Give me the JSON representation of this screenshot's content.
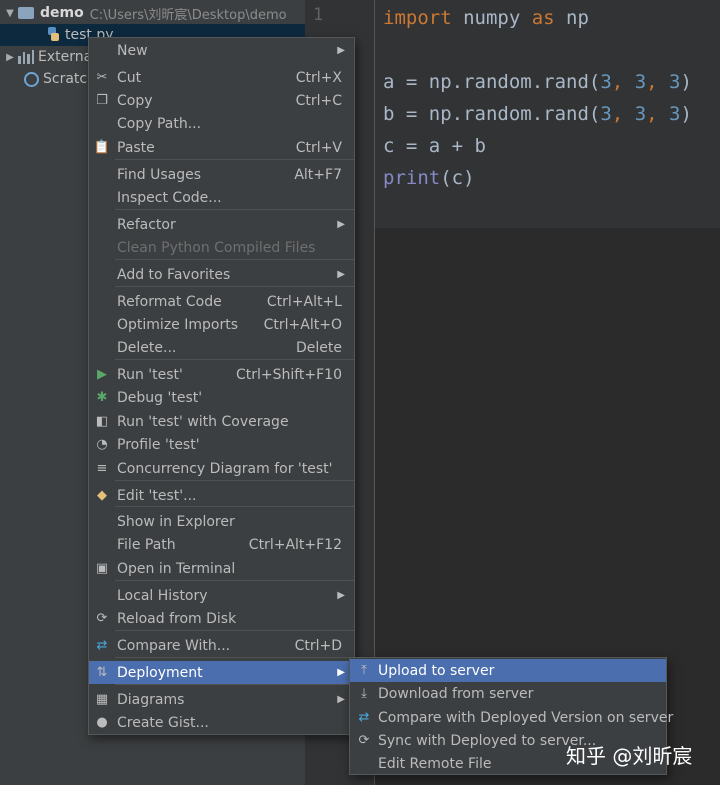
{
  "project_tree": {
    "root_name": "demo",
    "root_path": "C:\\Users\\刘昕宸\\Desktop\\demo",
    "file": "test.py",
    "external": "Externa",
    "scratch": "Scratch"
  },
  "editor": {
    "line_number": "1",
    "lines": [
      [
        "import",
        " numpy ",
        "as",
        " np"
      ],
      [
        "a = np.random.rand(",
        "3",
        ", ",
        "3",
        ", ",
        "3",
        ")"
      ],
      [
        "b = np.random.rand(",
        "3",
        ", ",
        "3",
        ", ",
        "3",
        ")"
      ],
      [
        "c = a + b"
      ],
      [
        "print",
        "(c)"
      ]
    ]
  },
  "context_menu": {
    "items": [
      {
        "label": "New",
        "shortcut": "",
        "icon": "none",
        "submenu": true
      },
      {
        "label": "Cut",
        "shortcut": "Ctrl+X",
        "icon": "scissors-icon"
      },
      {
        "label": "Copy",
        "shortcut": "Ctrl+C",
        "icon": "copy-icon"
      },
      {
        "label": "Copy Path...",
        "shortcut": "",
        "icon": "none"
      },
      {
        "label": "Paste",
        "shortcut": "Ctrl+V",
        "icon": "paste-icon"
      },
      {
        "label": "Find Usages",
        "shortcut": "Alt+F7",
        "icon": "none"
      },
      {
        "label": "Inspect Code...",
        "shortcut": "",
        "icon": "none"
      },
      {
        "label": "Refactor",
        "shortcut": "",
        "icon": "none",
        "submenu": true
      },
      {
        "label": "Clean Python Compiled Files",
        "shortcut": "",
        "icon": "none",
        "disabled": true
      },
      {
        "label": "Add to Favorites",
        "shortcut": "",
        "icon": "none",
        "submenu": true
      },
      {
        "label": "Reformat Code",
        "shortcut": "Ctrl+Alt+L",
        "icon": "none"
      },
      {
        "label": "Optimize Imports",
        "shortcut": "Ctrl+Alt+O",
        "icon": "none"
      },
      {
        "label": "Delete...",
        "shortcut": "Delete",
        "icon": "none"
      },
      {
        "label": "Run 'test'",
        "shortcut": "Ctrl+Shift+F10",
        "icon": "run-icon"
      },
      {
        "label": "Debug 'test'",
        "shortcut": "",
        "icon": "debug-icon"
      },
      {
        "label": "Run 'test' with Coverage",
        "shortcut": "",
        "icon": "coverage-icon"
      },
      {
        "label": "Profile 'test'",
        "shortcut": "",
        "icon": "profile-icon"
      },
      {
        "label": "Concurrency Diagram for 'test'",
        "shortcut": "",
        "icon": "concurrency-icon"
      },
      {
        "label": "Edit 'test'...",
        "shortcut": "",
        "icon": "python-icon"
      },
      {
        "label": "Show in Explorer",
        "shortcut": "",
        "icon": "none"
      },
      {
        "label": "File Path",
        "shortcut": "Ctrl+Alt+F12",
        "icon": "none"
      },
      {
        "label": "Open in Terminal",
        "shortcut": "",
        "icon": "terminal-icon"
      },
      {
        "label": "Local History",
        "shortcut": "",
        "icon": "none",
        "submenu": true
      },
      {
        "label": "Reload from Disk",
        "shortcut": "",
        "icon": "reload-icon"
      },
      {
        "label": "Compare With...",
        "shortcut": "Ctrl+D",
        "icon": "compare-icon"
      },
      {
        "label": "Deployment",
        "shortcut": "",
        "icon": "deployment-icon",
        "submenu": true,
        "highlighted": true
      },
      {
        "label": "Diagrams",
        "shortcut": "",
        "icon": "diagrams-icon",
        "submenu": true
      },
      {
        "label": "Create Gist...",
        "shortcut": "",
        "icon": "github-icon"
      }
    ]
  },
  "deployment_submenu": {
    "items": [
      {
        "label": "Upload to server",
        "icon": "upload-icon",
        "highlighted": true
      },
      {
        "label": "Download from server",
        "icon": "download-icon"
      },
      {
        "label": "Compare with Deployed Version on server",
        "icon": "compare-icon"
      },
      {
        "label": "Sync with Deployed to server...",
        "icon": "sync-icon"
      },
      {
        "label": "Edit Remote File",
        "icon": "none"
      }
    ]
  },
  "watermark": "知乎 @刘昕宸"
}
